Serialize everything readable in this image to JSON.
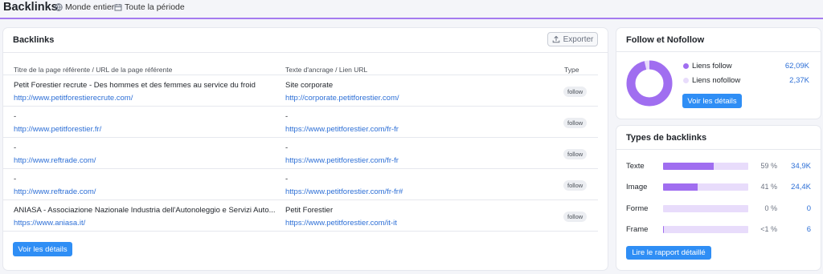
{
  "header": {
    "title": "Backlinks",
    "filter_region": "Monde entier",
    "filter_period": "Toute la période"
  },
  "main": {
    "title": "Backlinks",
    "export_label": "Exporter",
    "columns": [
      "Titre de la page référente / URL de la page référente",
      "Texte d'ancrage / Lien URL",
      "Type"
    ],
    "rows": [
      {
        "title": "Petit Forestier recrute - Des hommes et des femmes au service du froid",
        "source_url": "http://www.petitforestierecrute.com/",
        "anchor": "Site corporate",
        "target_url": "http://corporate.petitforestier.com/",
        "type": "follow"
      },
      {
        "title": "-",
        "source_url": "http://www.petitforestier.fr/",
        "anchor": "-",
        "target_url": "https://www.petitforestier.com/fr-fr",
        "type": "follow"
      },
      {
        "title": "-",
        "source_url": "http://www.reftrade.com/",
        "anchor": "-",
        "target_url": "https://www.petitforestier.com/fr-fr",
        "type": "follow"
      },
      {
        "title": "-",
        "source_url": "http://www.reftrade.com/",
        "anchor": "-",
        "target_url": "https://www.petitforestier.com/fr-fr#",
        "type": "follow"
      },
      {
        "title": "ANIASA - Associazione Nazionale Industria dell'Autonoleggio e Servizi Auto...",
        "source_url": "https://www.aniasa.it/",
        "anchor": "Petit Forestier",
        "target_url": "https://www.petitforestier.com/it-it",
        "type": "follow"
      }
    ],
    "details_label": "Voir les détails"
  },
  "follow": {
    "title": "Follow et Nofollow",
    "items": [
      {
        "label": "Liens follow",
        "value": "62,09K",
        "color": "#a06ef0"
      },
      {
        "label": "Liens nofollow",
        "value": "2,37K",
        "color": "#e8dcfb"
      }
    ],
    "follow_fraction": 0.963,
    "details_label": "Voir les détails"
  },
  "types": {
    "title": "Types de backlinks",
    "rows": [
      {
        "label": "Texte",
        "fraction": 0.59,
        "pct": "59 %",
        "count": "34,9K"
      },
      {
        "label": "Image",
        "fraction": 0.41,
        "pct": "41 %",
        "count": "24,4K"
      },
      {
        "label": "Forme",
        "fraction": 0.0,
        "pct": "0 %",
        "count": "0"
      },
      {
        "label": "Frame",
        "fraction": 0.003,
        "pct": "<1 %",
        "count": "6"
      }
    ],
    "report_label": "Lire le rapport détaillé"
  }
}
